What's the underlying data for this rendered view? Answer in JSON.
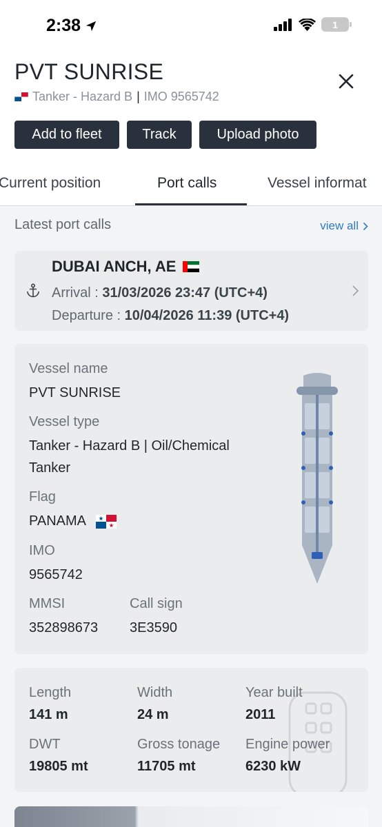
{
  "status_bar": {
    "time": "2:38",
    "battery": "1"
  },
  "header": {
    "title": "PVT SUNRISE",
    "subtitle_type": "Tanker - Hazard B",
    "subtitle_sep": "|",
    "subtitle_imo": "IMO 9565742"
  },
  "actions": {
    "add_to_fleet": "Add to fleet",
    "track": "Track",
    "upload_photo": "Upload photo"
  },
  "tabs": [
    {
      "label": "Current position",
      "active": false
    },
    {
      "label": "Port calls",
      "active": true
    },
    {
      "label": "Vessel informat",
      "active": false
    }
  ],
  "port_calls": {
    "title": "Latest port calls",
    "view_all": "view all",
    "latest": {
      "port": "DUBAI ANCH, AE",
      "arrival_label": "Arrival : ",
      "arrival_value": "31/03/2026 23:47 (UTC+4)",
      "departure_label": "Departure : ",
      "departure_value": "10/04/2026 11:39 (UTC+4)"
    }
  },
  "vessel_info": {
    "name_label": "Vessel name",
    "name_value": "PVT SUNRISE",
    "type_label": "Vessel type",
    "type_value_line1": "Tanker - Hazard B | Oil/Chemical",
    "type_value_line2": "Tanker",
    "flag_label": "Flag",
    "flag_value": "PANAMA",
    "imo_label": "IMO",
    "imo_value": "9565742",
    "mmsi_label": "MMSI",
    "mmsi_value": "352898673",
    "callsign_label": "Call sign",
    "callsign_value": "3E3590"
  },
  "specs": {
    "length_label": "Length",
    "length_value": "141 m",
    "width_label": "Width",
    "width_value": "24 m",
    "year_label": "Year built",
    "year_value": "2011",
    "dwt_label": "DWT",
    "dwt_value": "19805 mt",
    "gross_label": "Gross tonage",
    "gross_value": "11705 mt",
    "engine_label": "Engine power",
    "engine_value": "6230 kW"
  },
  "colors": {
    "button_bg": "#29323c",
    "link": "#2f79c7",
    "section_bg": "#f3f4f5",
    "card_bg": "#ebeced"
  },
  "icons": [
    "location-arrow-icon",
    "signal-icon",
    "wifi-icon",
    "battery-icon",
    "close-icon",
    "panama-flag-icon",
    "uae-flag-icon",
    "anchor-icon",
    "chevron-right-icon",
    "tanker-layout-icon"
  ]
}
